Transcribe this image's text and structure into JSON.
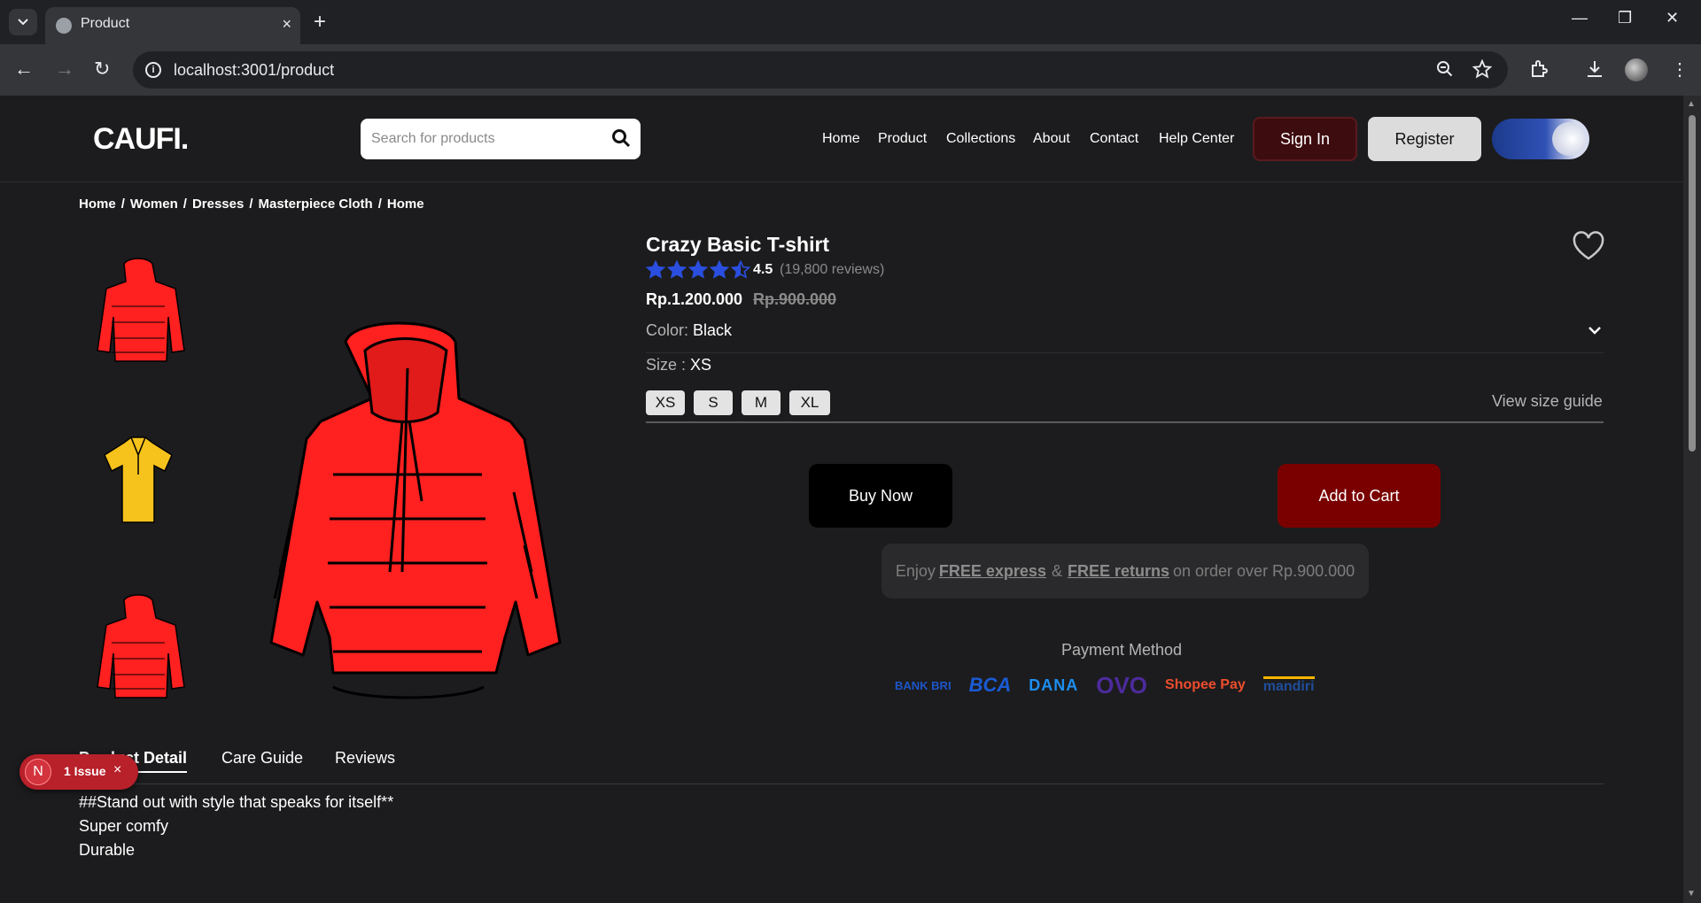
{
  "browser": {
    "tab_title": "Product",
    "url": "localhost:3001/product",
    "new_tab": "+",
    "tab_close": "×"
  },
  "header": {
    "logo": "CAUFI.",
    "search_placeholder": "Search for products",
    "nav": [
      "Home",
      "Product",
      "Collections",
      "About",
      "Contact",
      "Help Center"
    ],
    "sign_in": "Sign In",
    "register": "Register"
  },
  "breadcrumb": [
    "Home",
    "Women",
    "Dresses",
    "Masterpiece Cloth",
    "Home"
  ],
  "breadcrumb_sep": "/",
  "product": {
    "title": "Crazy Basic T-shirt",
    "rating": "4.5",
    "rating_value": 4.5,
    "reviews": "(19,800 reviews)",
    "price": "Rp.1.200.000",
    "old_price": "Rp.900.000",
    "color_label": "Color:",
    "color_value": "Black",
    "size_label": "Size :",
    "size_value": "XS",
    "sizes": [
      "XS",
      "S",
      "M",
      "XL"
    ],
    "size_guide": "View size guide",
    "buy_now": "Buy Now",
    "add_to_cart": "Add to Cart",
    "promo": {
      "p1": "Enjoy",
      "b1": "FREE express",
      "amp": "&",
      "b2": "FREE returns",
      "p2": "on order over Rp.900.000"
    },
    "payment_title": "Payment Method",
    "payment_methods": [
      "BANK BRI",
      "BCA",
      "DANA",
      "OVO",
      "Shopee Pay",
      "mandiri"
    ]
  },
  "tabs": [
    "Product Detail",
    "Care Guide",
    "Reviews"
  ],
  "description": [
    "##Stand out with style that speaks for itself**",
    "Super comfy",
    "Durable"
  ],
  "issue_badge": {
    "letter": "N",
    "text": "1 Issue",
    "close": "×"
  },
  "colors": {
    "accent_star": "#2a4fe0",
    "cart": "#7a0000",
    "signin": "#3d0c0f",
    "jacket": "#ff2020",
    "polo": "#f6c21c"
  }
}
